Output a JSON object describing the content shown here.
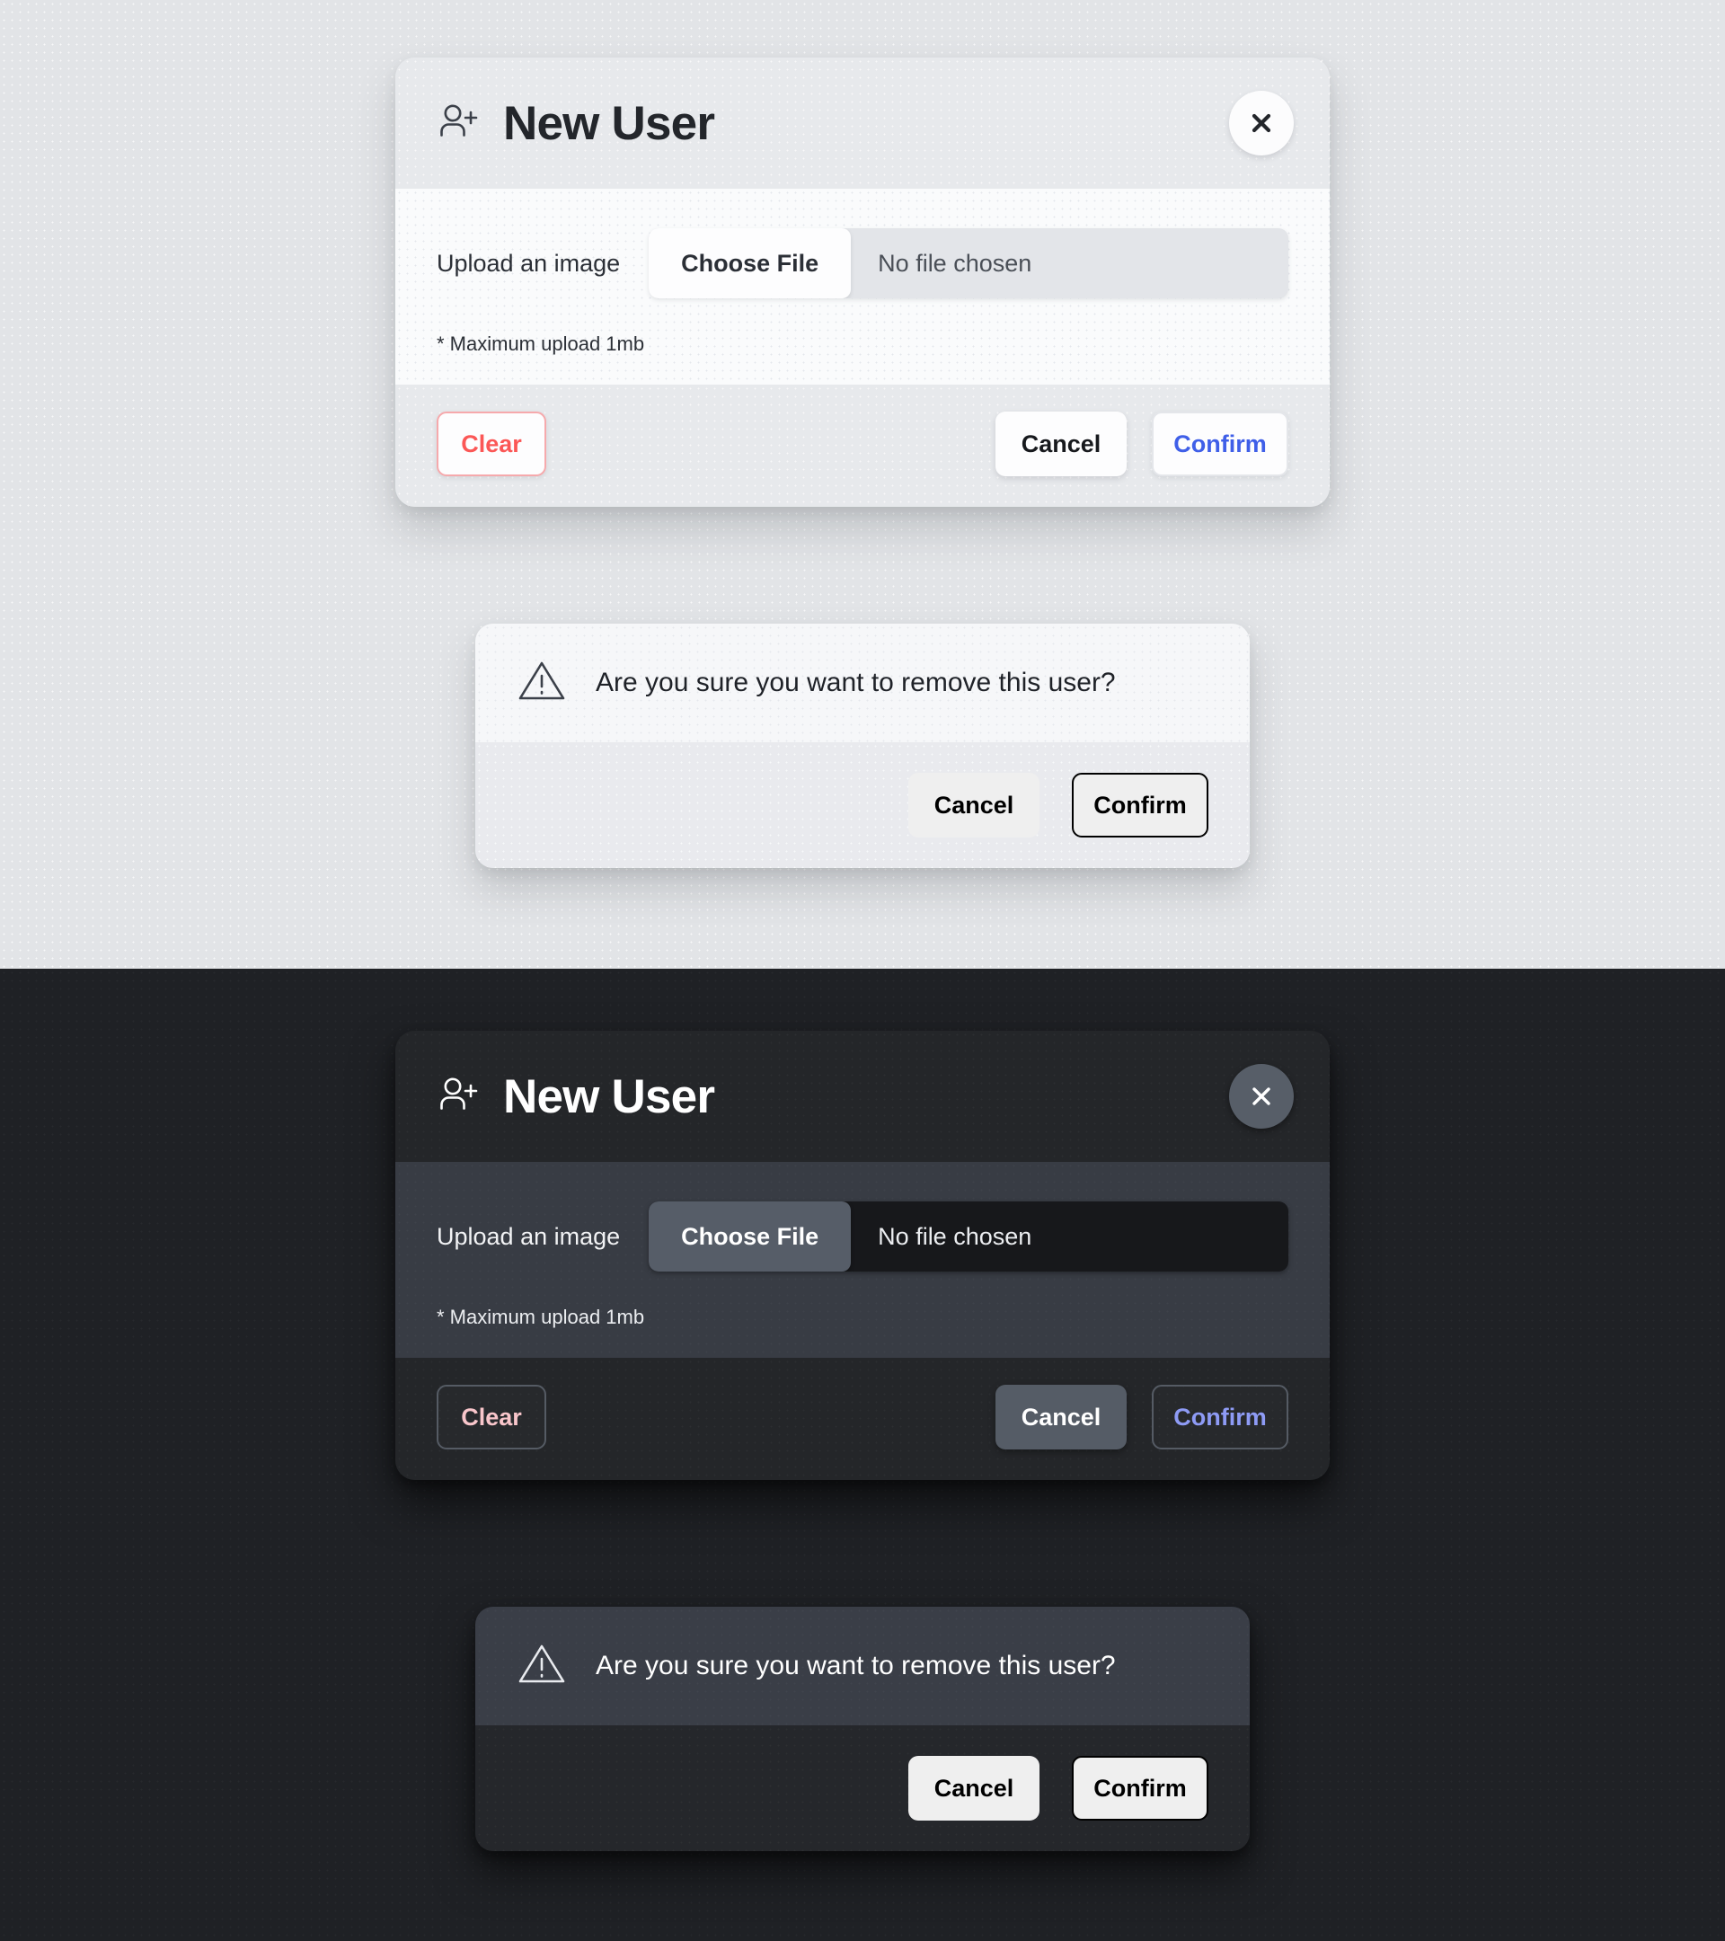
{
  "themes": {
    "light": {
      "modal": {
        "icon": "user-plus-icon",
        "title": "New User",
        "close_label": "✕",
        "upload_label": "Upload an image",
        "choose_file_label": "Choose File",
        "file_name": "No file chosen",
        "hint": "* Maximum upload 1mb",
        "clear_label": "Clear",
        "cancel_label": "Cancel",
        "confirm_label": "Confirm"
      },
      "dialog": {
        "icon": "warning-triangle-icon",
        "message": "Are you sure you want to remove this user?",
        "cancel_label": "Cancel",
        "confirm_label": "Confirm"
      }
    },
    "dark": {
      "modal": {
        "icon": "user-plus-icon",
        "title": "New User",
        "close_label": "✕",
        "upload_label": "Upload an image",
        "choose_file_label": "Choose File",
        "file_name": "No file chosen",
        "hint": "* Maximum upload 1mb",
        "clear_label": "Clear",
        "cancel_label": "Cancel",
        "confirm_label": "Confirm"
      },
      "dialog": {
        "icon": "warning-triangle-icon",
        "message": "Are you sure you want to remove this user?",
        "cancel_label": "Cancel",
        "confirm_label": "Confirm"
      }
    }
  },
  "colors": {
    "light_background": "#e2e4e7",
    "dark_background": "#1f2125",
    "light_confirm_text": "#3f5fe8",
    "light_clear_text": "#fb5756",
    "light_clear_border": "#f6a9ac",
    "dark_confirm_text": "#8e9bf5",
    "dark_clear_text": "#f9c6cb",
    "dark_button_fill": "#555c66"
  }
}
